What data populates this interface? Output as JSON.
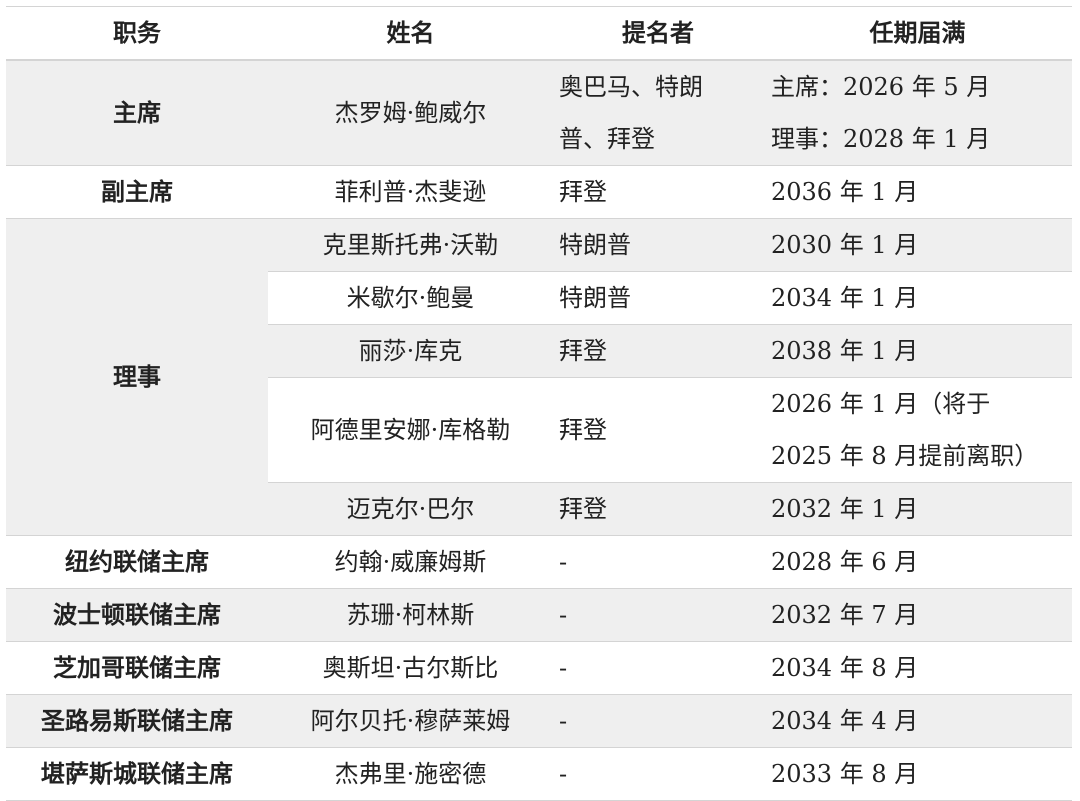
{
  "table": {
    "headers": [
      "职务",
      "姓名",
      "提名者",
      "任期届满"
    ],
    "chair": {
      "position": "主席",
      "name": "杰罗姆·鲍威尔",
      "nominator_line1": "奥巴马、特朗",
      "nominator_line2": "普、拜登",
      "term_line1": "主席：2026 年 5 月",
      "term_line2": "理事：2028 年 1 月"
    },
    "vice_chair": {
      "position": "副主席",
      "name": "菲利普·杰斐逊",
      "nominator": "拜登",
      "term": "2036 年 1 月"
    },
    "governors": {
      "position": "理事",
      "members": [
        {
          "name": "克里斯托弗·沃勒",
          "nominator": "特朗普",
          "term": "2030 年 1 月"
        },
        {
          "name": "米歇尔·鲍曼",
          "nominator": "特朗普",
          "term": "2034 年 1 月"
        },
        {
          "name": "丽莎·库克",
          "nominator": "拜登",
          "term": "2038 年 1 月"
        },
        {
          "name": "阿德里安娜·库格勒",
          "nominator": "拜登",
          "term_line1": "2026 年 1 月（将于",
          "term_line2": "2025 年 8 月提前离职）"
        },
        {
          "name": "迈克尔·巴尔",
          "nominator": "拜登",
          "term": "2032 年 1 月"
        }
      ]
    },
    "regional": [
      {
        "position": "纽约联储主席",
        "name": "约翰·威廉姆斯",
        "nominator": "-",
        "term": "2028 年 6 月"
      },
      {
        "position": "波士顿联储主席",
        "name": "苏珊·柯林斯",
        "nominator": "-",
        "term": "2032 年 7 月"
      },
      {
        "position": "芝加哥联储主席",
        "name": "奥斯坦·古尔斯比",
        "nominator": "-",
        "term": "2034 年 8 月"
      },
      {
        "position": "圣路易斯联储主席",
        "name": "阿尔贝托·穆萨莱姆",
        "nominator": "-",
        "term": "2034 年 4 月"
      },
      {
        "position": "堪萨斯城联储主席",
        "name": "杰弗里·施密德",
        "nominator": "-",
        "term": "2033 年 8 月"
      }
    ],
    "colors": {
      "shade": "#efefef",
      "rule": "#d4d4d4",
      "text": "#222222"
    }
  }
}
